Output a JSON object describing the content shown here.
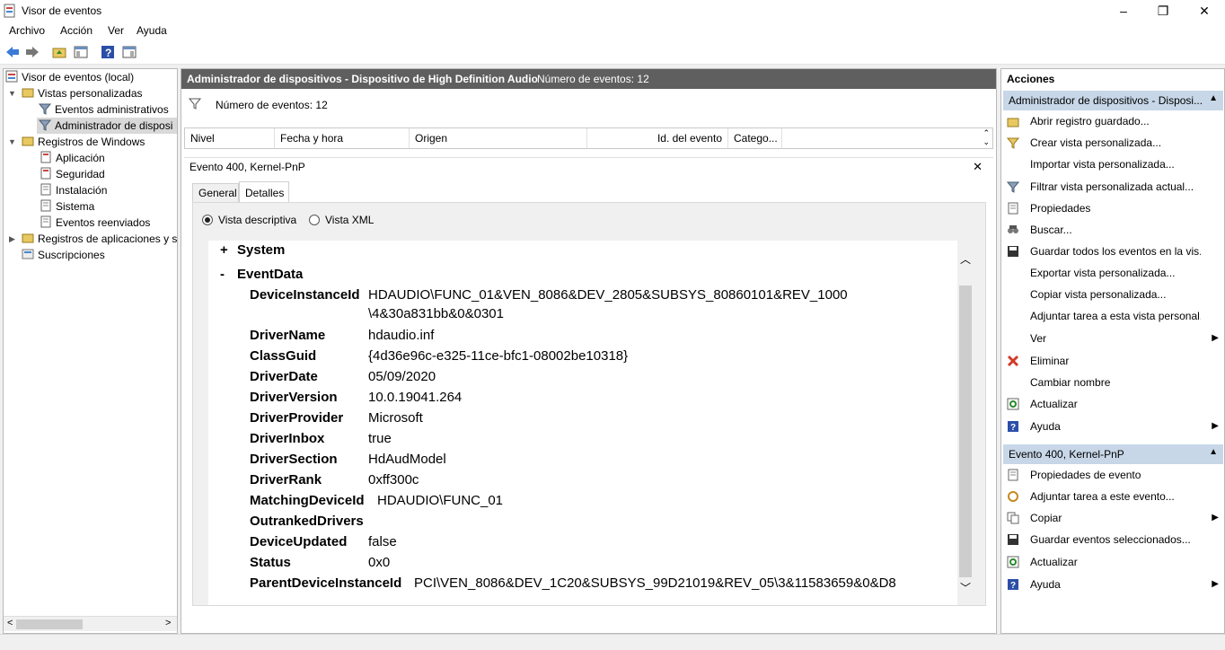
{
  "window": {
    "title": "Visor de eventos"
  },
  "menu": [
    "Archivo",
    "Acción",
    "Ver",
    "Ayuda"
  ],
  "tree": {
    "root": "Visor de eventos (local)",
    "custom_views": "Vistas personalizadas",
    "admin_events": "Eventos administrativos",
    "device_admin": "Administrador de disposi",
    "windows_logs": "Registros de Windows",
    "application": "Aplicación",
    "security": "Seguridad",
    "setup": "Instalación",
    "system": "Sistema",
    "forwarded": "Eventos reenviados",
    "apps_services": "Registros de aplicaciones y s",
    "subscriptions": "Suscripciones"
  },
  "center": {
    "header_title": "Administrador de dispositivos - Dispositivo de High Definition Audio",
    "header_count": "Número de eventos: 12",
    "filter_count": "Número de eventos: 12",
    "columns": [
      "Nivel",
      "Fecha y hora",
      "Origen",
      "Id. del evento",
      "Catego..."
    ],
    "event_title": "Evento 400, Kernel-PnP",
    "close_glyph": "✕",
    "tabs": [
      "General",
      "Detalles"
    ],
    "radio_friendly": "Vista descriptiva",
    "radio_xml": "Vista XML",
    "system_expander": "+",
    "system_label": "System",
    "eventdata_expander": "-",
    "eventdata_label": "EventData",
    "fields": [
      {
        "name": "DeviceInstanceId",
        "value": "HDAUDIO\\FUNC_01&VEN_8086&DEV_2805&SUBSYS_80860101&REV_1000",
        "value2": "\\4&30a831bb&0&0301"
      },
      {
        "name": "DriverName",
        "value": "hdaudio.inf"
      },
      {
        "name": "ClassGuid",
        "value": "{4d36e96c-e325-11ce-bfc1-08002be10318}"
      },
      {
        "name": "DriverDate",
        "value": "05/09/2020"
      },
      {
        "name": "DriverVersion",
        "value": "10.0.19041.264"
      },
      {
        "name": "DriverProvider",
        "value": "Microsoft"
      },
      {
        "name": "DriverInbox",
        "value": "true"
      },
      {
        "name": "DriverSection",
        "value": "HdAudModel"
      },
      {
        "name": "DriverRank",
        "value": "0xff300c"
      },
      {
        "name": "MatchingDeviceId",
        "value": "HDAUDIO\\FUNC_01"
      },
      {
        "name": "OutrankedDrivers",
        "value": ""
      },
      {
        "name": "DeviceUpdated",
        "value": "false"
      },
      {
        "name": "Status",
        "value": "0x0"
      },
      {
        "name": "ParentDeviceInstanceId",
        "value": "PCI\\VEN_8086&DEV_1C20&SUBSYS_99D21019&REV_05\\3&11583659&0&D8"
      }
    ]
  },
  "actions": {
    "title": "Acciones",
    "section1": "Administrador de dispositivos - Disposi...",
    "section1_items": [
      "Abrir registro guardado...",
      "Crear vista personalizada...",
      "Importar vista personalizada...",
      "Filtrar vista personalizada actual...",
      "Propiedades",
      "Buscar...",
      "Guardar todos los eventos en la vis...",
      "Exportar vista personalizada...",
      "Copiar vista personalizada...",
      "Adjuntar tarea a esta vista personal...",
      "Ver",
      "Eliminar",
      "Cambiar nombre",
      "Actualizar",
      "Ayuda"
    ],
    "section2": "Evento 400, Kernel-PnP",
    "section2_items": [
      "Propiedades de evento",
      "Adjuntar tarea a este evento...",
      "Copiar",
      "Guardar eventos seleccionados...",
      "Actualizar",
      "Ayuda"
    ]
  },
  "colors": {
    "accent_header": "#5f5f5f",
    "section_bg": "#c7d7e8",
    "delete_red": "#d23b2b",
    "help_blue": "#2b4fa8"
  }
}
